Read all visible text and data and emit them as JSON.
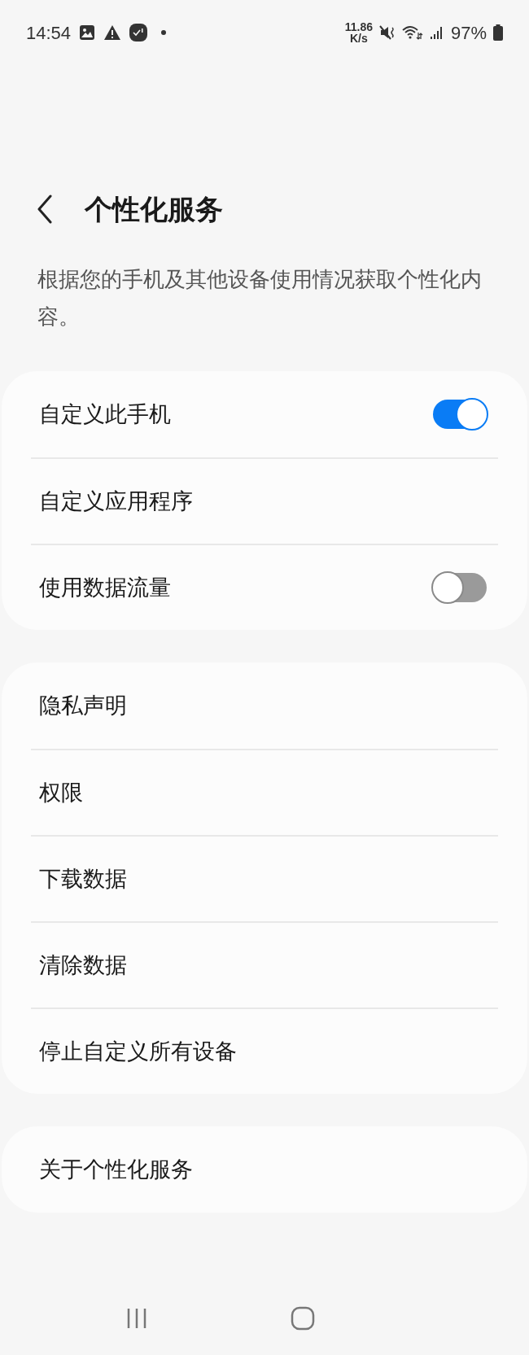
{
  "status_bar": {
    "time": "14:54",
    "speed_value": "11.86",
    "speed_unit": "K/s",
    "battery": "97%"
  },
  "header": {
    "title": "个性化服务"
  },
  "description": "根据您的手机及其他设备使用情况获取个性化内容。",
  "groups": [
    {
      "items": [
        {
          "label": "自定义此手机",
          "kind": "toggle",
          "on": true
        },
        {
          "label": "自定义应用程序",
          "kind": "link"
        },
        {
          "label": "使用数据流量",
          "kind": "toggle",
          "on": false
        }
      ]
    },
    {
      "items": [
        {
          "label": "隐私声明",
          "kind": "link"
        },
        {
          "label": "权限",
          "kind": "link"
        },
        {
          "label": "下载数据",
          "kind": "link"
        },
        {
          "label": "清除数据",
          "kind": "link"
        },
        {
          "label": "停止自定义所有设备",
          "kind": "link"
        }
      ]
    },
    {
      "items": [
        {
          "label": "关于个性化服务",
          "kind": "link"
        }
      ]
    }
  ]
}
